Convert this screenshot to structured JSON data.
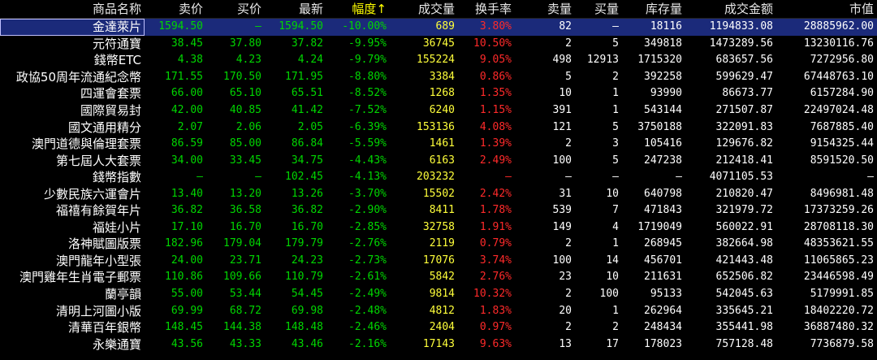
{
  "header": {
    "columns": [
      "商品名称",
      "卖价",
      "买价",
      "最新",
      "幅度↑",
      "成交量",
      "换手率",
      "卖量",
      "买量",
      "库存量",
      "成交金额",
      "市值"
    ]
  },
  "colors": {
    "price": "#00d600",
    "neutral": "#ffffff",
    "turnover": "#ff2a2a",
    "volume_low": "#ffff3a",
    "selected_row": "#1b2a7a"
  },
  "rows": [
    {
      "name": "金達萊片",
      "sell": "1594.50",
      "buy": "—",
      "last": "1594.50",
      "change": "-10.00%",
      "volume": "689",
      "turnover": "3.80%",
      "sell_qty": "82",
      "buy_qty": "—",
      "stock": "18116",
      "amount": "1194833.08",
      "mcap": "28885962.00"
    },
    {
      "name": "元符通寶",
      "sell": "38.45",
      "buy": "37.80",
      "last": "37.82",
      "change": "-9.95%",
      "volume": "36745",
      "turnover": "10.50%",
      "sell_qty": "2",
      "buy_qty": "5",
      "stock": "349818",
      "amount": "1473289.56",
      "mcap": "13230116.76"
    },
    {
      "name": "錢幣ETC",
      "sell": "4.38",
      "buy": "4.23",
      "last": "4.24",
      "change": "-9.79%",
      "volume": "155224",
      "turnover": "9.05%",
      "sell_qty": "498",
      "buy_qty": "12913",
      "stock": "1715320",
      "amount": "683657.56",
      "mcap": "7272956.80"
    },
    {
      "name": "政協50周年流通紀念幣",
      "sell": "171.55",
      "buy": "170.50",
      "last": "171.95",
      "change": "-8.80%",
      "volume": "3384",
      "turnover": "0.86%",
      "sell_qty": "5",
      "buy_qty": "2",
      "stock": "392258",
      "amount": "599629.47",
      "mcap": "67448763.10"
    },
    {
      "name": "四運會套票",
      "sell": "66.00",
      "buy": "65.10",
      "last": "65.51",
      "change": "-8.52%",
      "volume": "1268",
      "turnover": "1.35%",
      "sell_qty": "10",
      "buy_qty": "1",
      "stock": "93990",
      "amount": "86673.77",
      "mcap": "6157284.90"
    },
    {
      "name": "國際貿易封",
      "sell": "42.00",
      "buy": "40.85",
      "last": "41.42",
      "change": "-7.52%",
      "volume": "6240",
      "turnover": "1.15%",
      "sell_qty": "391",
      "buy_qty": "1",
      "stock": "543144",
      "amount": "271507.87",
      "mcap": "22497024.48"
    },
    {
      "name": "國文通用精分",
      "sell": "2.07",
      "buy": "2.06",
      "last": "2.05",
      "change": "-6.39%",
      "volume": "153136",
      "turnover": "4.08%",
      "sell_qty": "121",
      "buy_qty": "5",
      "stock": "3750188",
      "amount": "322091.83",
      "mcap": "7687885.40"
    },
    {
      "name": "澳門道德與倫理套票",
      "sell": "86.59",
      "buy": "85.00",
      "last": "86.84",
      "change": "-5.59%",
      "volume": "1461",
      "turnover": "1.39%",
      "sell_qty": "2",
      "buy_qty": "3",
      "stock": "105416",
      "amount": "129676.82",
      "mcap": "9154325.44"
    },
    {
      "name": "第七屆人大套票",
      "sell": "34.00",
      "buy": "33.45",
      "last": "34.75",
      "change": "-4.43%",
      "volume": "6163",
      "turnover": "2.49%",
      "sell_qty": "100",
      "buy_qty": "5",
      "stock": "247238",
      "amount": "212418.41",
      "mcap": "8591520.50"
    },
    {
      "name": "錢幣指數",
      "sell": "—",
      "buy": "—",
      "last": "102.45",
      "change": "-4.13%",
      "volume": "203232",
      "turnover": "—",
      "sell_qty": "—",
      "buy_qty": "—",
      "stock": "—",
      "amount": "4071105.53",
      "mcap": "—"
    },
    {
      "name": "少數民族六運會片",
      "sell": "13.40",
      "buy": "13.20",
      "last": "13.26",
      "change": "-3.70%",
      "volume": "15502",
      "turnover": "2.42%",
      "sell_qty": "31",
      "buy_qty": "10",
      "stock": "640798",
      "amount": "210820.47",
      "mcap": "8496981.48"
    },
    {
      "name": "福禧有餘賀年片",
      "sell": "36.82",
      "buy": "36.58",
      "last": "36.82",
      "change": "-2.90%",
      "volume": "8411",
      "turnover": "1.78%",
      "sell_qty": "539",
      "buy_qty": "7",
      "stock": "471843",
      "amount": "321979.72",
      "mcap": "17373259.26"
    },
    {
      "name": "福娃小片",
      "sell": "17.10",
      "buy": "16.70",
      "last": "16.70",
      "change": "-2.85%",
      "volume": "32758",
      "turnover": "1.91%",
      "sell_qty": "149",
      "buy_qty": "4",
      "stock": "1719049",
      "amount": "560022.91",
      "mcap": "28708118.30"
    },
    {
      "name": "洛神賦圖版票",
      "sell": "182.96",
      "buy": "179.04",
      "last": "179.79",
      "change": "-2.76%",
      "volume": "2119",
      "turnover": "0.79%",
      "sell_qty": "2",
      "buy_qty": "1",
      "stock": "268945",
      "amount": "382664.98",
      "mcap": "48353621.55"
    },
    {
      "name": "澳門龍年小型張",
      "sell": "24.00",
      "buy": "23.71",
      "last": "24.23",
      "change": "-2.73%",
      "volume": "17076",
      "turnover": "3.74%",
      "sell_qty": "100",
      "buy_qty": "14",
      "stock": "456701",
      "amount": "421443.48",
      "mcap": "11065865.23"
    },
    {
      "name": "澳門雞年生肖電子郵票",
      "sell": "110.86",
      "buy": "109.66",
      "last": "110.79",
      "change": "-2.61%",
      "volume": "5842",
      "turnover": "2.76%",
      "sell_qty": "23",
      "buy_qty": "10",
      "stock": "211631",
      "amount": "652506.82",
      "mcap": "23446598.49"
    },
    {
      "name": "蘭亭韻",
      "sell": "55.00",
      "buy": "53.44",
      "last": "54.45",
      "change": "-2.49%",
      "volume": "9814",
      "turnover": "10.32%",
      "sell_qty": "2",
      "buy_qty": "100",
      "stock": "95133",
      "amount": "542045.63",
      "mcap": "5179991.85"
    },
    {
      "name": "清明上河圖小版",
      "sell": "69.99",
      "buy": "68.72",
      "last": "69.98",
      "change": "-2.48%",
      "volume": "4812",
      "turnover": "1.83%",
      "sell_qty": "20",
      "buy_qty": "1",
      "stock": "262964",
      "amount": "335645.21",
      "mcap": "18402220.72"
    },
    {
      "name": "清華百年銀幣",
      "sell": "148.45",
      "buy": "144.38",
      "last": "148.48",
      "change": "-2.46%",
      "volume": "2404",
      "turnover": "0.97%",
      "sell_qty": "2",
      "buy_qty": "2",
      "stock": "248434",
      "amount": "355441.98",
      "mcap": "36887480.32"
    },
    {
      "name": "永樂通寶",
      "sell": "43.56",
      "buy": "43.33",
      "last": "43.46",
      "change": "-2.16%",
      "volume": "17143",
      "turnover": "9.63%",
      "sell_qty": "13",
      "buy_qty": "17",
      "stock": "178023",
      "amount": "757128.48",
      "mcap": "7736879.58"
    }
  ]
}
